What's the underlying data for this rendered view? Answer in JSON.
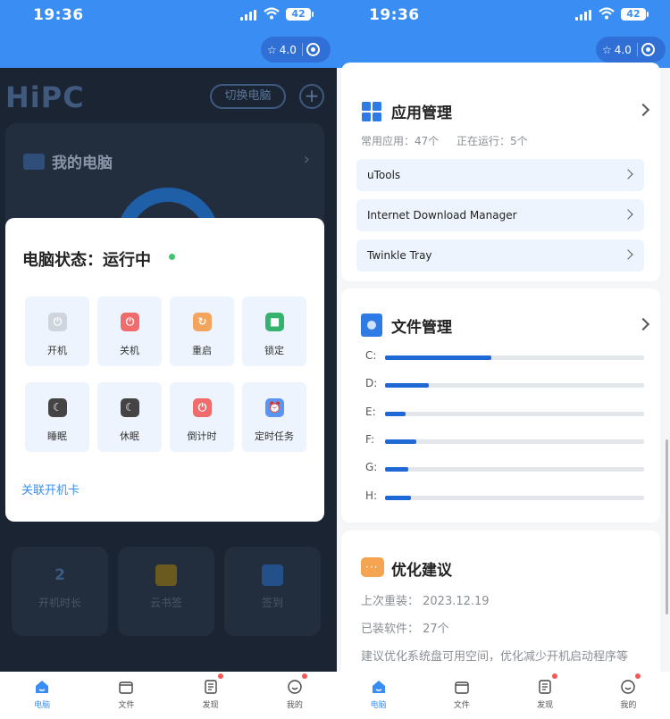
{
  "status": {
    "time": "19:36",
    "battery": "42"
  },
  "capsule": {
    "label": "4.0"
  },
  "left": {
    "brand": "HiPC",
    "switch_label": "切换电脑",
    "card_title": "我的电脑",
    "bg_tiles": [
      {
        "value": "2",
        "label": "开机时长"
      },
      {
        "label": "云书签"
      },
      {
        "label": "签到"
      }
    ],
    "modal": {
      "status_label": "电脑状态：运行中",
      "actions": [
        {
          "label": "开机",
          "color": "#cfd5dc"
        },
        {
          "label": "关机",
          "color": "#f06b6b"
        },
        {
          "label": "重启",
          "color": "#f3a55d"
        },
        {
          "label": "锁定",
          "color": "#33b36b"
        },
        {
          "label": "睡眠",
          "color": "#444444"
        },
        {
          "label": "休眠",
          "color": "#444444"
        },
        {
          "label": "倒计时",
          "color": "#f06b6b"
        },
        {
          "label": "定时任务",
          "color": "#5a95f5"
        }
      ],
      "link": "关联开机卡"
    }
  },
  "right": {
    "apps": {
      "title": "应用管理",
      "common": "常用应用：47个",
      "running": "正在运行：5个",
      "items": [
        "uTools",
        "Internet Download Manager",
        "Twinkle Tray"
      ]
    },
    "files": {
      "title": "文件管理",
      "drives": [
        {
          "name": "C:",
          "used": 0.41
        },
        {
          "name": "D:",
          "used": 0.17
        },
        {
          "name": "E:",
          "used": 0.08
        },
        {
          "name": "F:",
          "used": 0.12
        },
        {
          "name": "G:",
          "used": 0.09
        },
        {
          "name": "H:",
          "used": 0.1
        }
      ]
    },
    "opt": {
      "title": "优化建议",
      "reinstall": "上次重装：  2023.12.19",
      "software": "已装软件：  27个",
      "advice": "建议优化系统盘可用空间，优化减少开机启动程序等"
    }
  },
  "tabs": [
    {
      "label": "电脑",
      "active": true,
      "badge": false
    },
    {
      "label": "文件",
      "active": false,
      "badge": false
    },
    {
      "label": "发现",
      "active": false,
      "badge": true
    },
    {
      "label": "我的",
      "active": false,
      "badge": true
    }
  ]
}
